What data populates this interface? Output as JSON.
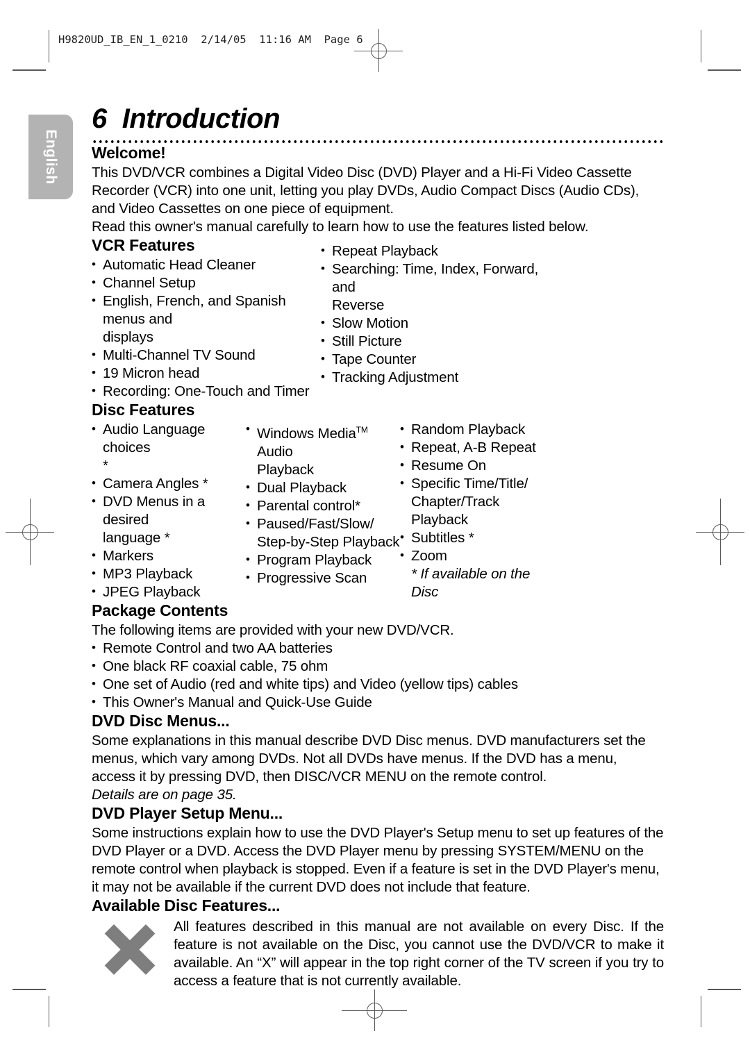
{
  "print_marks": {
    "slug_text": "H9820UD_IB_EN_1_0210  2/14/05  11:16 AM  Page 6"
  },
  "language_tab": {
    "label": "English"
  },
  "page_header": {
    "number": "6",
    "title": "Introduction"
  },
  "sections": {
    "welcome": {
      "heading": "Welcome!",
      "paragraphs": [
        "This DVD/VCR combines a Digital Video Disc (DVD) Player and a Hi-Fi Video Cassette Recorder (VCR) into one unit, letting you play DVDs, Audio Compact Discs (Audio CDs), and Video Cassettes on one piece of equipment.",
        "Read this owner's manual carefully to learn how to use the features listed below."
      ]
    },
    "vcr_features": {
      "heading": "VCR Features",
      "column_left": [
        "Automatic Head Cleaner",
        "Channel Setup",
        "English, French, and Spanish menus and",
        "displays",
        "Multi-Channel TV Sound",
        "19 Micron head",
        "Recording: One-Touch and Timer"
      ],
      "column_right": [
        "Repeat Playback",
        "Searching: Time, Index, Forward, and",
        "Reverse",
        "Slow Motion",
        "Still Picture",
        "Tape Counter",
        "Tracking Adjustment"
      ]
    },
    "disc_features": {
      "heading": "Disc Features",
      "column_1": [
        "Audio Language choices",
        "*",
        "Camera Angles *",
        "DVD Menus in a desired",
        "language *",
        "Markers",
        "MP3 Playback",
        "JPEG Playback"
      ],
      "column_2_first_pre": "Windows Media",
      "column_2_first_tm": "TM",
      "column_2_first_post": " Audio",
      "column_2": [
        "Playback",
        "Dual Playback",
        "Parental control*",
        "Paused/Fast/Slow/",
        "Step-by-Step Playback",
        "Program Playback",
        "Progressive Scan"
      ],
      "column_3": [
        "Random Playback",
        "Repeat, A-B Repeat",
        "Resume On",
        "Specific Time/Title/",
        "Chapter/Track Playback",
        "Subtitles *",
        "Zoom"
      ],
      "footnote": "* If available on the Disc"
    },
    "package_contents": {
      "heading": "Package Contents",
      "intro": "The following items are provided with your new DVD/VCR.",
      "items": [
        "Remote Control and two AA batteries",
        "One black RF coaxial cable, 75 ohm",
        "One set of Audio (red and white tips) and Video (yellow tips) cables",
        "This Owner's Manual and Quick-Use Guide"
      ]
    },
    "dvd_disc_menus": {
      "heading": "DVD Disc Menus...",
      "body": "Some explanations in this manual describe DVD Disc menus. DVD manufacturers set the menus, which vary among DVDs. Not all DVDs have menus. If the DVD has a menu, access it by pressing DVD, then DISC/VCR MENU on the remote control.",
      "reference": "Details are on page 35."
    },
    "dvd_player_setup_menu": {
      "heading": "DVD Player Setup Menu...",
      "body": "Some instructions explain how to use the DVD Player's Setup menu to set up features of the DVD Player or a DVD. Access the DVD Player menu by pressing SYSTEM/MENU on the remote control when playback is stopped. Even if a feature is set in the DVD Player's menu, it may not be available if the current DVD does not include that feature."
    },
    "available_disc_features": {
      "heading": "Available Disc Features...",
      "icon": "x-mark-icon",
      "body": "All features described in this manual are not available on every Disc. If the feature is not available on the Disc, you cannot use the DVD/VCR to make it available. An “X” will appear in the top right corner of the TV screen if you try to access a feature that is not currently available."
    }
  },
  "colors": {
    "tab_background": "#b3b3b3",
    "tab_text": "#ffffff",
    "x_icon": "#7e7e7e",
    "mark_gray": "#58585a",
    "text": "#000000"
  }
}
